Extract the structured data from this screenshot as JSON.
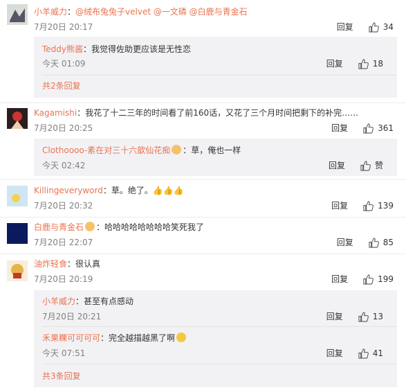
{
  "comments": [
    {
      "user": "小羊威力",
      "sep": "：",
      "text": "@绒布兔兔子velvet @一文磷 @白鹿与青金石",
      "time": "7月20日 20:17",
      "reply_label": "回复",
      "likes": "34",
      "avatar_color": "#cfd6cf",
      "replies": [
        {
          "user": "Teddy熊酱",
          "sep": "：",
          "text": "我觉得佐助更应该是无性恋",
          "time": "今天 01:09",
          "reply_label": "回复",
          "likes": "18"
        }
      ],
      "more": "共2条回复"
    },
    {
      "user": "Kagamishi",
      "sep": "：",
      "text": "我花了十二三年的时间看了前160话，又花了三个月时间把剩下的补完……",
      "time": "7月20日 20:25",
      "reply_label": "回复",
      "likes": "361",
      "avatar_color": "#3a2a2a",
      "replies": [
        {
          "user": "Clothoooo-素在对三十六歆仙花痴",
          "sep": "：草，俺也一样",
          "text": "",
          "time": "今天 02:42",
          "reply_label": "回复",
          "likes": "赞"
        }
      ]
    },
    {
      "user": "Killingeveryword",
      "sep": "：",
      "text": "草。绝了。",
      "time": "7月20日 20:32",
      "reply_label": "回复",
      "likes": "139",
      "avatar_color": "#bfe0f0"
    },
    {
      "user": "白鹿与青金石",
      "sep": "：",
      "text": "哈哈哈哈哈哈哈哈笑死我了",
      "time": "7月20日 22:07",
      "reply_label": "回复",
      "likes": "85",
      "avatar_color": "#0b1a5c"
    },
    {
      "user": "油炸轻食",
      "sep": "：",
      "text": "很认真",
      "time": "7月20日 20:19",
      "reply_label": "回复",
      "likes": "199",
      "avatar_color": "#e8c070",
      "replies": [
        {
          "user": "小羊威力",
          "sep": "：",
          "text": "甚至有点感动",
          "time": "7月20日 20:21",
          "reply_label": "回复",
          "likes": "13"
        },
        {
          "user": "禾果粿可可可可",
          "sep": "：",
          "text": "完全越描越黑了啊",
          "time": "今天 07:51",
          "reply_label": "回复",
          "likes": "41"
        }
      ],
      "more": "共3条回复"
    }
  ],
  "colors": {
    "accent": "#eb7350",
    "muted": "#808080",
    "reply_bg": "#f2f2f5"
  }
}
